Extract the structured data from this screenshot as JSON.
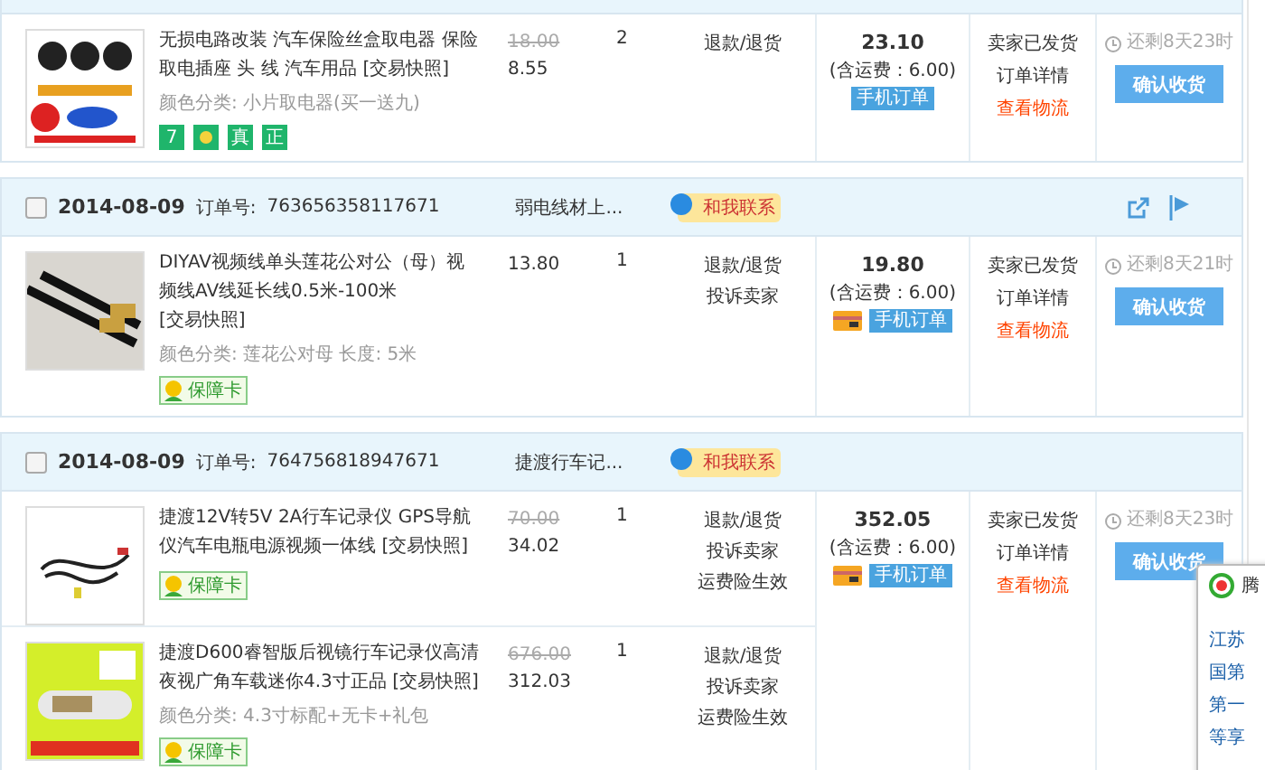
{
  "orders": [
    {
      "items": [
        {
          "title": "无损电路改装 汽车保险丝盒取电器 保险取电插座 头 线 汽车用品 ",
          "snapshot": "[交易快照]",
          "sku": "颜色分类: 小片取电器(买一送九)",
          "original_price": "18.00",
          "price": "8.55",
          "qty": "2",
          "actions": [
            "退款/退货"
          ],
          "badges": [
            {
              "kind": "text",
              "text": "7"
            },
            {
              "kind": "icon"
            },
            {
              "kind": "text",
              "text": "真"
            },
            {
              "kind": "text",
              "text": "正"
            }
          ]
        }
      ],
      "total": "23.10",
      "shipping": "(含运费：6.00)",
      "card": false,
      "mobile": "手机订单",
      "status": [
        "卖家已发货",
        "订单详情"
      ],
      "logistics": "查看物流",
      "countdown": "还剩8天23时",
      "confirm": "确认收货"
    },
    {
      "date": "2014-08-09",
      "order_label": "订单号:",
      "order_no": "763656358117671",
      "seller": "弱电线材上...",
      "contact": "和我联系",
      "checked": false,
      "tools": true,
      "items": [
        {
          "title": "DIYAV视频线单头莲花公对公（母）视频线AV线延长线0.5米-100米 ",
          "snapshot": "[交易快照]",
          "sku": "颜色分类: 莲花公对母 长度: 5米",
          "price": "13.80",
          "qty": "1",
          "actions": [
            "退款/退货",
            "投诉卖家"
          ],
          "badges": [
            {
              "kind": "card",
              "text": "保障卡"
            }
          ]
        }
      ],
      "total": "19.80",
      "shipping": "(含运费：6.00)",
      "card": true,
      "mobile": "手机订单",
      "status": [
        "卖家已发货",
        "订单详情"
      ],
      "logistics": "查看物流",
      "countdown": "还剩8天21时",
      "confirm": "确认收货"
    },
    {
      "date": "2014-08-09",
      "order_label": "订单号:",
      "order_no": "764756818947671",
      "seller": "捷渡行车记...",
      "contact": "和我联系",
      "checked": false,
      "tools": false,
      "items": [
        {
          "title": "捷渡12V转5V 2A行车记录仪 GPS导航仪汽车电瓶电源视频一体线 ",
          "snapshot": "[交易快照]",
          "original_price": "70.00",
          "price": "34.02",
          "qty": "1",
          "actions": [
            "退款/退货",
            "投诉卖家",
            "运费险生效"
          ],
          "badges": [
            {
              "kind": "card",
              "text": "保障卡"
            }
          ]
        },
        {
          "title": "捷渡D600睿智版后视镜行车记录仪高清夜视广角车载迷你4.3寸正品 ",
          "snapshot": "[交易快照]",
          "sku": "颜色分类: 4.3寸标配+无卡+礼包",
          "original_price": "676.00",
          "price": "312.03",
          "qty": "1",
          "actions": [
            "退款/退货",
            "投诉卖家",
            "运费险生效"
          ],
          "badges": [
            {
              "kind": "card",
              "text": "保障卡"
            }
          ]
        }
      ],
      "total": "352.05",
      "shipping": "(含运费：6.00)",
      "card": true,
      "mobile": "手机订单",
      "status": [
        "卖家已发货",
        "订单详情"
      ],
      "logistics": "查看物流",
      "countdown": "还剩8天23时",
      "confirm": "确认收货"
    }
  ],
  "popup": {
    "title": "腾",
    "lines": [
      "江苏",
      "国第",
      "第一",
      "等享"
    ]
  }
}
